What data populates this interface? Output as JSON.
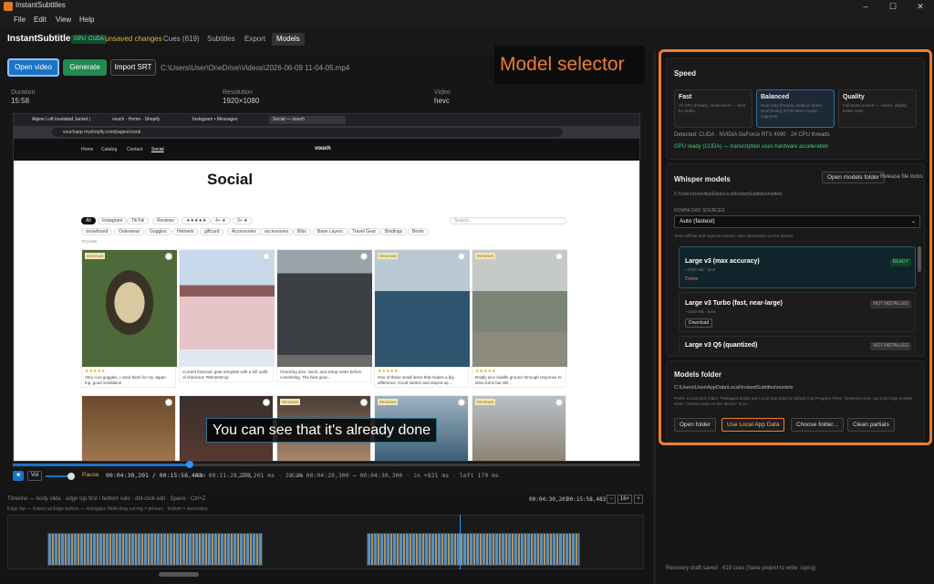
{
  "window": {
    "title": "InstantSubtitles",
    "controls": [
      "–",
      "☐",
      "✕"
    ]
  },
  "menu": [
    "File",
    "Edit",
    "View",
    "Help"
  ],
  "app": {
    "name": "InstantSubtitles",
    "badges": [
      "GPU",
      "CUDA"
    ],
    "unsaved": "unsaved changes",
    "tabs": [
      {
        "label": "Cues (619)"
      },
      {
        "label": "Subtitles"
      },
      {
        "label": "Export"
      },
      {
        "label": "Models",
        "active": true
      }
    ]
  },
  "toolbar": {
    "open_video": "Open video",
    "generate": "Generate",
    "import_srt": "Import SRT",
    "path": "C:\\Users\\User\\OneDrive\\Videos\\2026-06-09 11-04-05.mp4",
    "annotation": "Model selector"
  },
  "info": {
    "duration_label": "Duration",
    "duration": "15:58",
    "resolution_label": "Resolution",
    "resolution": "1920×1080",
    "video_label": "Video",
    "video": "hevc"
  },
  "browser": {
    "tabs": [
      "Alpine Loft Insulated Jacket |",
      "vouch - Home - Shopify",
      "Instagram • Messages",
      "Social — vouch"
    ],
    "url": "vouchapp.myshopify.com/pages/social",
    "nav": [
      "Home",
      "Catalog",
      "Contact",
      "Social"
    ],
    "brand": "vouch",
    "heading": "Social",
    "search_placeholder": "Search...",
    "chips1": [
      "All",
      "Instagram",
      "TikTok",
      "Reviews",
      "★★★★★",
      "4+ ★",
      "3+ ★"
    ],
    "chips2": [
      "snowboard",
      "Outerwear",
      "Goggles",
      "Helmets",
      "giftcard",
      "Accessories",
      "accessories",
      "Bibs",
      "Base Layers",
      "Travel Gear",
      "Bindings",
      "Boots"
    ],
    "count": "73 posts",
    "cards": [
      {
        "badge": "REVIEWS",
        "stars": "★★★★★",
        "text": "Very cool goggles, I used them for my Japan trip, good ventilation"
      },
      {
        "badge": "",
        "stars": "",
        "text": "Current forecast: gear template with a full outfit of checkout: #WinterDrop"
      },
      {
        "badge": "",
        "stars": "",
        "text": "Checking size, stock, and setup notes before committing. The best gear..."
      },
      {
        "badge": "REVIEWS",
        "stars": "★★★★★",
        "text": "One of these small items that makes a big difference. Good stretch and stayed up..."
      },
      {
        "badge": "REVIEWS",
        "stars": "★★★★★",
        "text": "Really nice middle ground. Enough response to drive turns but still..."
      }
    ],
    "row2_badges": [
      "",
      "",
      "REVIEWS",
      "REVIEWS",
      "REVIEWS"
    ]
  },
  "caption": "You can see that it's already done",
  "player": {
    "play_icon": "■",
    "vol": "Vol",
    "pause": "Pause",
    "time": "00:04:30,201 / 00:15:58,483",
    "rem": "rem 00:11:28,201",
    "ms": "270,201 ms · 28.2%",
    "cue": "Cue 00:04:29,300 → 00:04:30,300 · in +821 ms · left 179 ms"
  },
  "timeline": {
    "help": "Timeline — body slide · edge top first / bottom solo · dbl-click edit · Space · Ctrl+Z",
    "legend": "Edge top — linked cut    Edge bottom — solo/gaps    Shift+drag cut-mg = primary · bottom = secondary",
    "time": "00:04:30,201",
    "time2": "00:15:58,483",
    "zoom": [
      "−",
      "16×",
      "+"
    ]
  },
  "speed": {
    "title": "Speed",
    "options": [
      {
        "name": "Fast",
        "desc": "All CPU threads, small beam — best for drafts."
      },
      {
        "name": "Balanced",
        "desc": "Near-max threads, medium beam · word timing (DTW when model supports)",
        "selected": true
      },
      {
        "name": "Quality",
        "desc": "Full beam search — slower, slightly better cues."
      }
    ],
    "detected_label": "Detected:",
    "detected": "CUDA · NVIDIA GeForce RTX 4090 · 24 CPU threads",
    "gpu_ready": "GPU ready (CUDA) — transcription uses hardware acceleration"
  },
  "whisper": {
    "title": "Whisper models",
    "open_folder": "Open models folder",
    "release": "Release file locks",
    "path": "C:\\Users\\User\\AppData\\Local\\InstantSubtitles\\models",
    "sources_label": "DOWNLOAD SOURCES",
    "source": "Auto (fastest)",
    "sources_hint": "Tests Official and regional mirrors, then downloads via the fastest.",
    "models": [
      {
        "name": "Large v3 (max accuracy)",
        "size": "~3000 MB · best",
        "status": "READY",
        "action": "Delete"
      },
      {
        "name": "Large v3 Turbo (fast, near-large)",
        "size": "~1530 MB · best",
        "status": "NOT INSTALLED",
        "action": "Download"
      },
      {
        "name": "Large v3 Q5 (quantized)",
        "size": "",
        "status": "NOT INSTALLED",
        "action": ""
      }
    ]
  },
  "folder": {
    "title": "Models folder",
    "path": "C:\\Users\\User\\AppData\\Local\\InstantSubtitles\\models",
    "hint": "Prefer a local disk folder. Packaged builds use Local App Data by default (not Program Files). OneDrive sync can lock large models when \"Always keep on this device\" is on.",
    "buttons": [
      "Open folder",
      "Use Local App Data",
      "Choose folder...",
      "Clean partials"
    ]
  },
  "statusbar": "Recovery draft saved · 619 cues (Save project to write .isproj)",
  "colors": {
    "accent": "#f07d2d",
    "primary": "#1a73c8",
    "success": "#1f8a52"
  }
}
